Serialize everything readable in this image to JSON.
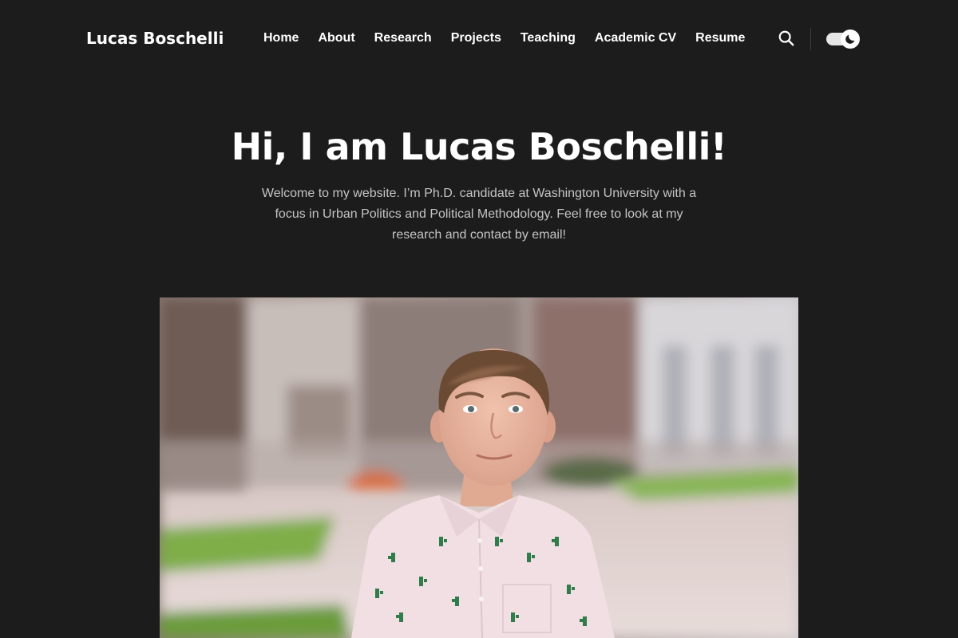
{
  "site": {
    "title": "Lucas Boschelli"
  },
  "nav": {
    "items": [
      {
        "label": "Home"
      },
      {
        "label": "About"
      },
      {
        "label": "Research"
      },
      {
        "label": "Projects"
      },
      {
        "label": "Teaching"
      },
      {
        "label": "Academic CV"
      },
      {
        "label": "Resume"
      }
    ]
  },
  "header_actions": {
    "search_icon": "search-icon",
    "theme_toggle_icon": "moon-icon",
    "theme_mode": "dark"
  },
  "hero": {
    "title": "Hi, I am Lucas Boschelli!",
    "intro": "Welcome to my website. I’m Ph.D. candidate at Washington University with a focus in Urban Politics and Political Methodology. Feel free to look at my research and contact by email!"
  },
  "portrait": {
    "subject": "portrait-photo"
  },
  "colors": {
    "background": "#1c1c1c",
    "text": "#ffffff",
    "muted_text": "#c4c4c4",
    "divider": "#3d3d3d"
  }
}
